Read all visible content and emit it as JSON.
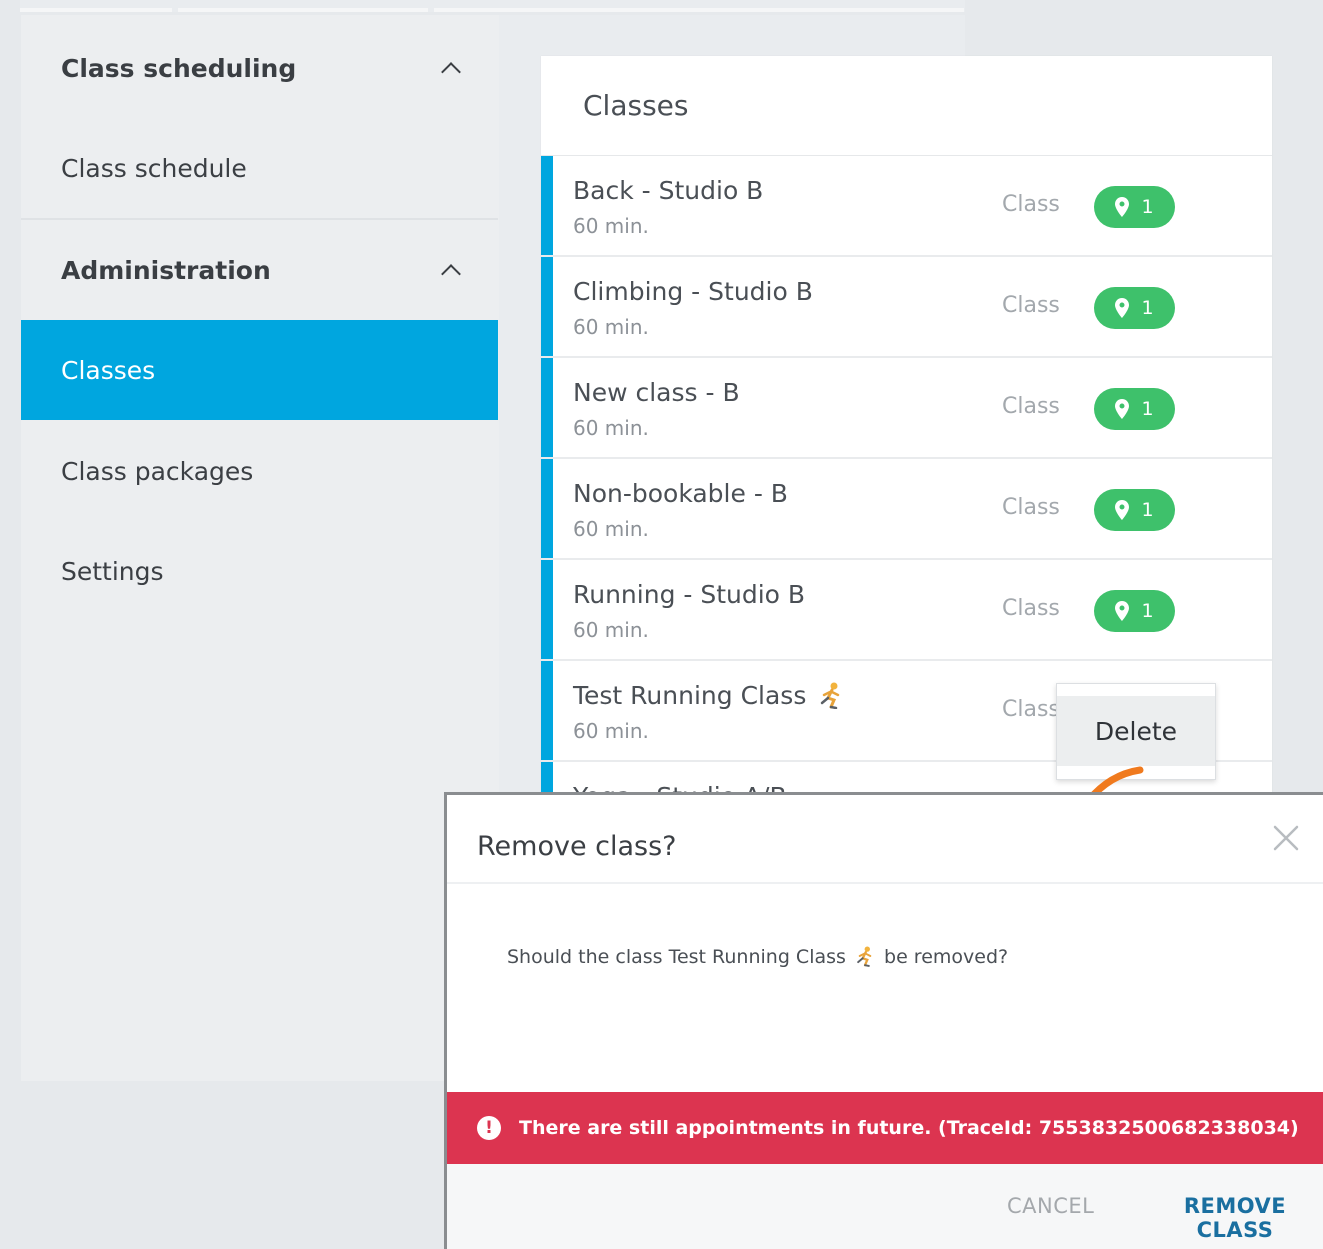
{
  "sidebar": {
    "sections": [
      {
        "label": "Class scheduling",
        "items": [
          "Class schedule"
        ]
      },
      {
        "label": "Administration",
        "items": [
          "Classes",
          "Class packages",
          "Settings"
        ]
      }
    ],
    "active_item": "Classes"
  },
  "classes_panel": {
    "title": "Classes",
    "rows": [
      {
        "name": "Back - Studio B",
        "duration": "60 min.",
        "type": "Class",
        "locations": "1"
      },
      {
        "name": "Climbing - Studio B",
        "duration": "60 min.",
        "type": "Class",
        "locations": "1"
      },
      {
        "name": "New class - B",
        "duration": "60 min.",
        "type": "Class",
        "locations": "1"
      },
      {
        "name": "Non-bookable - B",
        "duration": "60 min.",
        "type": "Class",
        "locations": "1"
      },
      {
        "name": "Running - Studio B",
        "duration": "60 min.",
        "type": "Class",
        "locations": "1"
      },
      {
        "name": "Test Running Class",
        "duration": "60 min.",
        "type": "Class"
      },
      {
        "name": "Yoga - Studio A/B"
      }
    ]
  },
  "context_menu": {
    "items": [
      "Delete"
    ]
  },
  "dialog": {
    "title": "Remove class?",
    "body_prefix": "Should the class Test Running Class",
    "body_suffix": "be removed?",
    "error": "There are still appointments in future. (TraceId: 7553832500682338034)",
    "cancel_label": "CANCEL",
    "confirm_label": "REMOVE CLASS"
  },
  "colors": {
    "accent": "#00a6df",
    "badge": "#3ec16b",
    "error": "#dc3450",
    "primary_button": "#1a6fa0",
    "annotation_arrow": "#f07a1e"
  },
  "icons": {
    "badge": "map-pin-icon",
    "emoji": "running-person-icon",
    "close": "close-icon",
    "error": "exclamation-circle-icon",
    "section_toggle": "chevron-up-icon"
  }
}
